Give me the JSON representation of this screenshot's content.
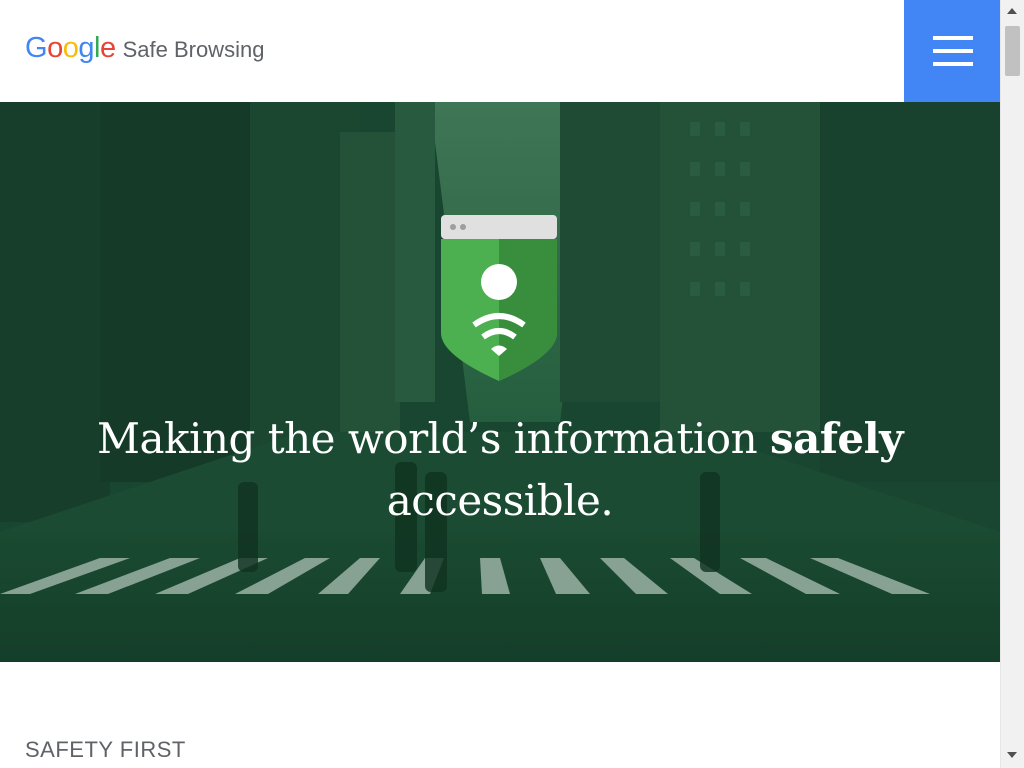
{
  "header": {
    "logo": {
      "letters": [
        {
          "ch": "G",
          "color": "#4285f4"
        },
        {
          "ch": "o",
          "color": "#ea4335"
        },
        {
          "ch": "o",
          "color": "#fbbc05"
        },
        {
          "ch": "g",
          "color": "#4285f4"
        },
        {
          "ch": "l",
          "color": "#34a853"
        },
        {
          "ch": "e",
          "color": "#ea4335"
        }
      ],
      "product": "Safe Browsing"
    },
    "menu": {
      "icon": "hamburger-menu-icon",
      "color": "#4285f4"
    }
  },
  "hero": {
    "headline_part1": "Making the world’s information ",
    "headline_bold": "safely",
    "headline_part2": "accessible.",
    "shield_icon": "safe-browsing-shield-icon",
    "overlay_color": "#1b5e3b"
  },
  "section": {
    "label": "SAFETY FIRST"
  }
}
